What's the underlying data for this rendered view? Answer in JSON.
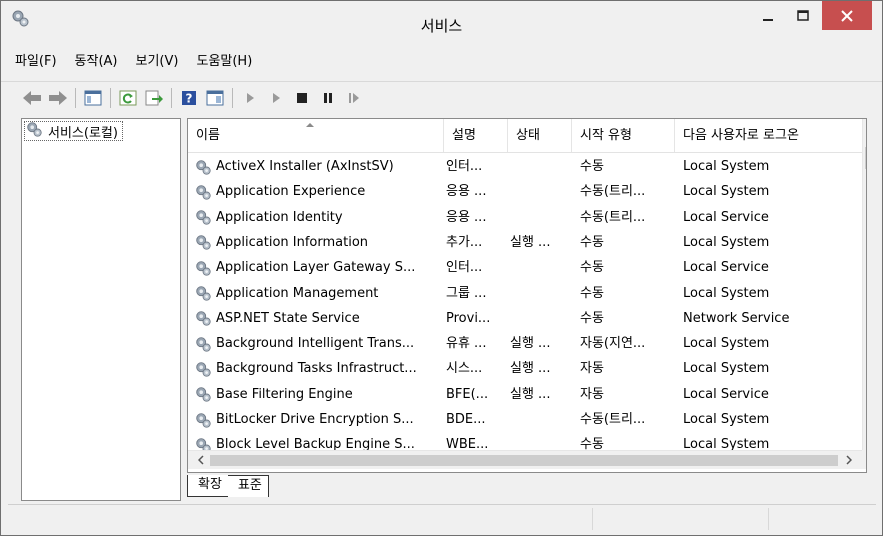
{
  "window": {
    "title": "서비스"
  },
  "menu": [
    "파일(F)",
    "동작(A)",
    "보기(V)",
    "도움말(H)"
  ],
  "toolbar_icons": [
    "back-arrow-icon",
    "forward-arrow-icon",
    "console-tree-icon",
    "refresh-icon",
    "export-list-icon",
    "help-icon",
    "properties-icon",
    "start-service-icon",
    "start-service-alt-icon",
    "stop-service-icon",
    "pause-service-icon",
    "resume-service-icon"
  ],
  "tree": {
    "root_label": "서비스(로컬)"
  },
  "columns": [
    "이름",
    "설명",
    "상태",
    "시작 유형",
    "다음 사용자로 로그온"
  ],
  "rows": [
    {
      "name": "ActiveX Installer (AxInstSV)",
      "desc": "인터...",
      "status": "",
      "startup": "수동",
      "logon": "Local System"
    },
    {
      "name": "Application Experience",
      "desc": "응용 ...",
      "status": "",
      "startup": "수동(트리...",
      "logon": "Local System"
    },
    {
      "name": "Application Identity",
      "desc": "응용 ...",
      "status": "",
      "startup": "수동(트리...",
      "logon": "Local Service"
    },
    {
      "name": "Application Information",
      "desc": "추가...",
      "status": "실행 ...",
      "startup": "수동",
      "logon": "Local System"
    },
    {
      "name": "Application Layer Gateway S...",
      "desc": "인터...",
      "status": "",
      "startup": "수동",
      "logon": "Local Service"
    },
    {
      "name": "Application Management",
      "desc": "그룹 ...",
      "status": "",
      "startup": "수동",
      "logon": "Local System"
    },
    {
      "name": "ASP.NET State Service",
      "desc": "Provi...",
      "status": "",
      "startup": "수동",
      "logon": "Network Service"
    },
    {
      "name": "Background Intelligent Trans...",
      "desc": "유휴 ...",
      "status": "실행 ...",
      "startup": "자동(지연...",
      "logon": "Local System"
    },
    {
      "name": "Background Tasks Infrastruct...",
      "desc": "시스...",
      "status": "실행 ...",
      "startup": "자동",
      "logon": "Local System"
    },
    {
      "name": "Base Filtering Engine",
      "desc": "BFE(...",
      "status": "실행 ...",
      "startup": "자동",
      "logon": "Local Service"
    },
    {
      "name": "BitLocker Drive Encryption S...",
      "desc": "BDE...",
      "status": "",
      "startup": "수동(트리...",
      "logon": "Local System"
    },
    {
      "name": "Block Level Backup Engine S...",
      "desc": "WBE...",
      "status": "",
      "startup": "수동",
      "logon": "Local System"
    }
  ],
  "tabs": [
    "확장",
    "표준"
  ],
  "colors": {
    "close_button": "#c74f4f",
    "window_bg": "#f0f0f0"
  }
}
